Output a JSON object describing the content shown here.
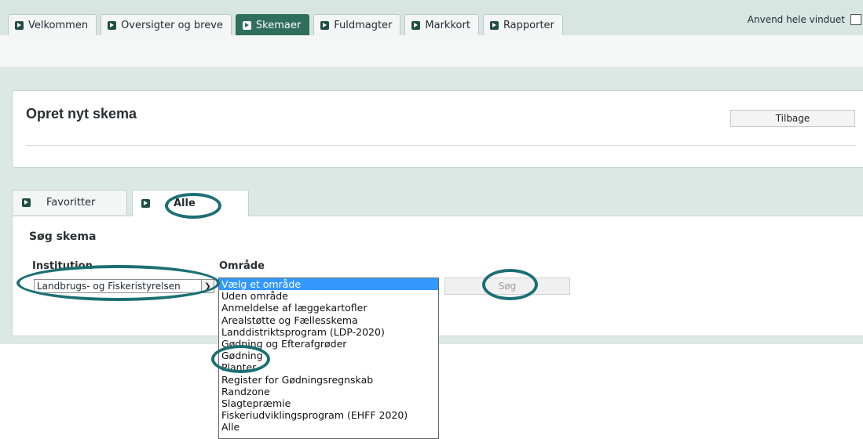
{
  "top_tabs": [
    {
      "label": "Velkommen"
    },
    {
      "label": "Oversigter og breve"
    },
    {
      "label": "Skemaer"
    },
    {
      "label": "Fuldmagter"
    },
    {
      "label": "Markkort"
    },
    {
      "label": "Rapporter"
    }
  ],
  "active_top_tab": "Skemaer",
  "whole_window_label": "Anvend hele vinduet",
  "page_title": "Opret nyt skema",
  "back_button": "Tilbage",
  "inner_tabs": [
    {
      "label": "Favoritter"
    },
    {
      "label": "Alle"
    }
  ],
  "active_inner_tab": "Alle",
  "search": {
    "title": "Søg skema",
    "institution_label": "Institution",
    "institution_value": "Landbrugs- og Fiskeristyrelsen",
    "area_label": "Område",
    "search_button": "Søg"
  },
  "area_options": [
    "Vælg et område",
    "Uden område",
    "Anmeldelse af læggekartofler",
    "Arealstøtte og Fællesskema",
    "Landdistriktsprogram (LDP-2020)",
    "Gødning og Efterafgrøder",
    "Gødning",
    "Planter",
    "Register for Gødningsregnskab",
    "Randzone",
    "Slagtepræmie",
    "Fiskeriudviklingsprogram (EHFF 2020)",
    "Alle"
  ],
  "selected_area_index": 0,
  "colors": {
    "tab_active": "#2f6e5c",
    "annotation_ring": "#1c6f73",
    "dropdown_highlight": "#3399ff"
  }
}
